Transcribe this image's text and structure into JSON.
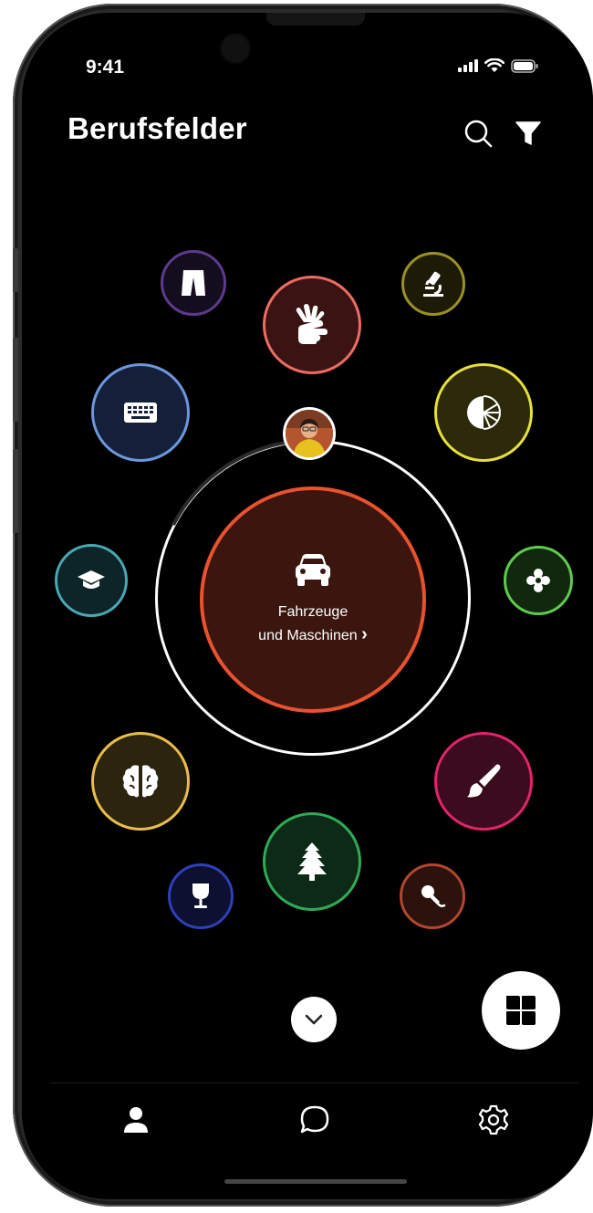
{
  "status": {
    "time": "9:41",
    "signal_icon": "cellular-signal-icon",
    "wifi_icon": "wifi-icon",
    "battery_icon": "battery-icon"
  },
  "header": {
    "title": "Berufsfelder",
    "search_icon": "search-icon",
    "filter_icon": "filter-icon"
  },
  "center": {
    "icon": "car-icon",
    "label_line1": "Fahrzeuge",
    "label_line2": "und Maschinen",
    "chevron": "›",
    "accent": "#e9512f",
    "fill": "#3a160f"
  },
  "fields": [
    {
      "icon": "clothing-icon",
      "border": "#5d3a8c",
      "fill": "#140d1e"
    },
    {
      "icon": "sign-language-icon",
      "border": "#ee6b63",
      "fill": "#3a1412"
    },
    {
      "icon": "microscope-icon",
      "border": "#9a9124",
      "fill": "#1d1b08"
    },
    {
      "icon": "keyboard-icon",
      "border": "#6e96dc",
      "fill": "#14203a"
    },
    {
      "icon": "chart-icon",
      "border": "#e5e03a",
      "fill": "#2d2a0b"
    },
    {
      "icon": "graduation-cap-icon",
      "border": "#49a8b3",
      "fill": "#0d2428"
    },
    {
      "icon": "flower-icon",
      "border": "#5ecb4c",
      "fill": "#11280e"
    },
    {
      "icon": "brain-icon",
      "border": "#e9bd4a",
      "fill": "#2d2410"
    },
    {
      "icon": "paintbrush-icon",
      "border": "#e2236a",
      "fill": "#3a0c1d"
    },
    {
      "icon": "tree-icon",
      "border": "#2faa58",
      "fill": "#0c2a16"
    },
    {
      "icon": "wine-glass-icon",
      "border": "#2f3fb8",
      "fill": "#0d1030"
    },
    {
      "icon": "microphone-icon",
      "border": "#b2462e",
      "fill": "#2b120c"
    }
  ],
  "controls": {
    "scroll_down_icon": "chevron-down-icon",
    "fab_icon": "grid-view-icon"
  },
  "tabbar": {
    "profile_icon": "profile-icon",
    "chat_icon": "chat-bubble-icon",
    "settings_icon": "gear-icon"
  }
}
